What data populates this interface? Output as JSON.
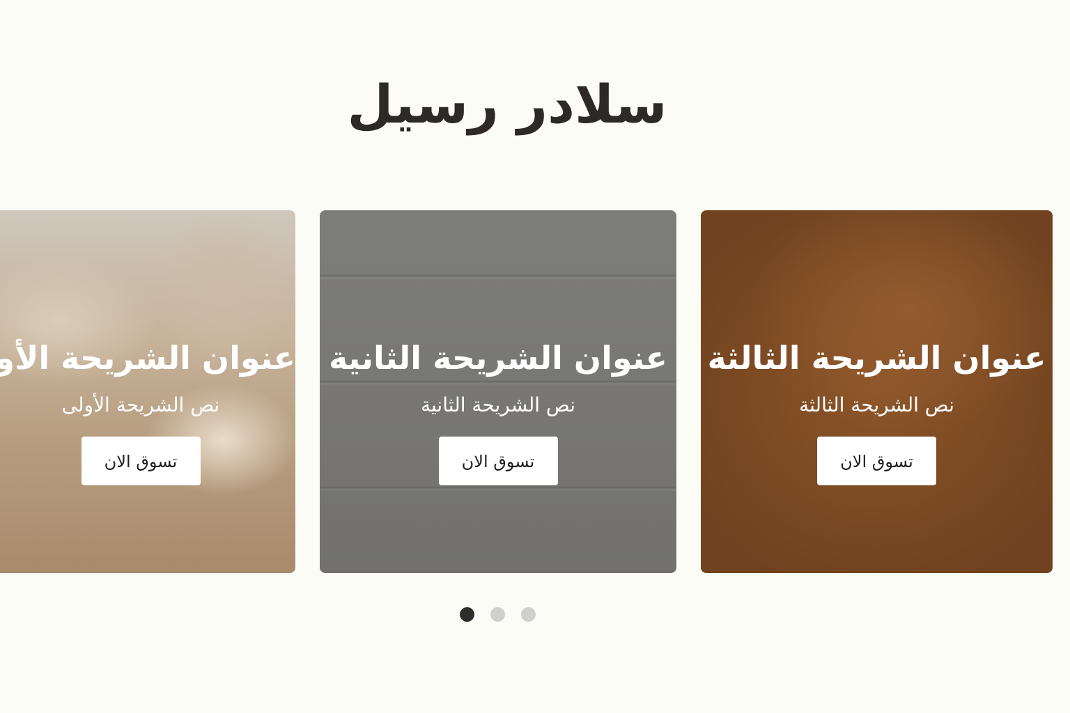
{
  "page": {
    "title": "سلادر رسيل"
  },
  "slides": [
    {
      "heading": "عنوان الشريحة الأولى",
      "text": "نص الشريحة الأولى",
      "button_label": "تسوق الان"
    },
    {
      "heading": "عنوان الشريحة الثانية",
      "text": "نص الشريحة الثانية",
      "button_label": "تسوق الان"
    },
    {
      "heading": "عنوان الشريحة الثالثة",
      "text": "نص الشريحة الثالثة",
      "button_label": "تسوق الان"
    }
  ],
  "pagination": {
    "count": 3,
    "active_index": 0
  },
  "colors": {
    "background": "#fcfcf7",
    "title_text": "#2d2927",
    "slide_2_background": "#777773",
    "slide_3_background": "#7a4a23",
    "dot_active": "#2e2e2e",
    "dot_inactive": "#cfcfcd"
  }
}
